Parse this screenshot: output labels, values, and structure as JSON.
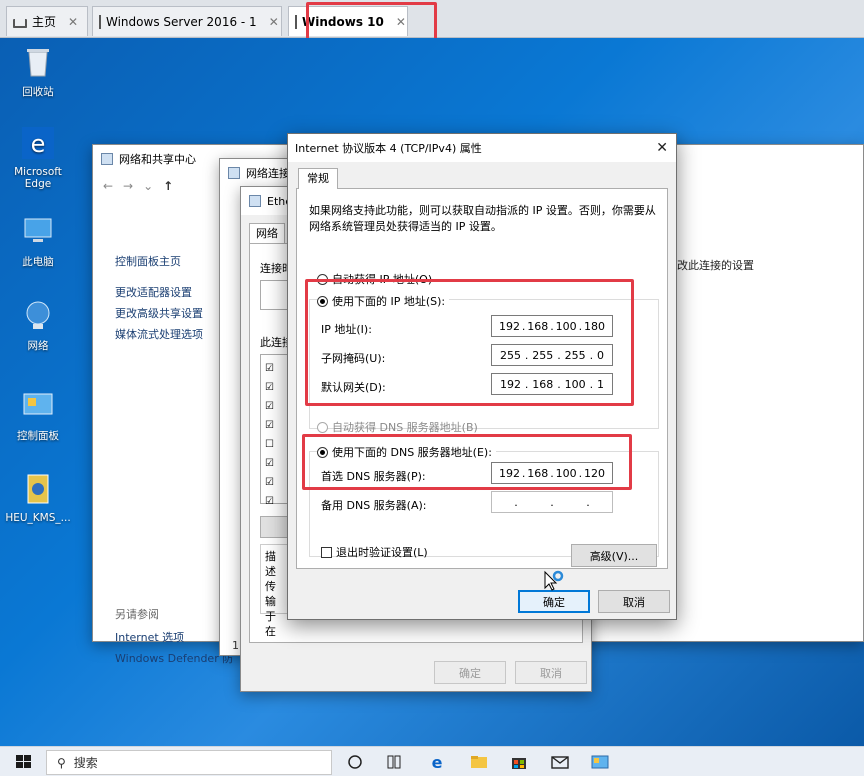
{
  "tabs": [
    {
      "label": "主页"
    },
    {
      "label": "Windows Server 2016 - 1"
    },
    {
      "label": "Windows 10"
    }
  ],
  "desktop_icons": [
    {
      "label": "回收站"
    },
    {
      "label": "Microsoft Edge"
    },
    {
      "label": "此电脑"
    },
    {
      "label": "网络"
    },
    {
      "label": "控制面板"
    },
    {
      "label": "HEU_KMS_..."
    }
  ],
  "network_center": {
    "title": "网络和共享中心",
    "left_links": [
      "控制面板主页",
      "更改适配器设置",
      "更改高级共享设置",
      "媒体流式处理选项"
    ],
    "see_also": "另请参阅",
    "bottom_links": [
      "Internet 选项",
      "Windows Defender 防"
    ],
    "right_link": "改此连接的设置"
  },
  "network_connections": {
    "title": "网络连接",
    "digit": "1"
  },
  "ethernet_props": {
    "title": "Ethe",
    "tab": "网络",
    "connect_using": "连接时",
    "items_label": "此连接",
    "desc_label": "描述",
    "desc_lines": [
      "传输",
      "于在"
    ],
    "ok": "确定",
    "cancel": "取消"
  },
  "dialog": {
    "title": "Internet 协议版本 4 (TCP/IPv4) 属性",
    "tab": "常规",
    "description": "如果网络支持此功能，则可以获取自动指派的 IP 设置。否则，你需要从网络系统管理员处获得适当的 IP 设置。",
    "auto_ip": "自动获得 IP 地址(O)",
    "manual_ip": "使用下面的 IP 地址(S):",
    "ip_label": "IP 地址(I):",
    "ip_value": [
      "192",
      "168",
      "100",
      "180"
    ],
    "mask_label": "子网掩码(U):",
    "mask_value": [
      "255",
      "255",
      "255",
      "0"
    ],
    "gateway_label": "默认网关(D):",
    "gateway_value": [
      "192",
      "168",
      "100",
      "1"
    ],
    "auto_dns": "自动获得 DNS 服务器地址(B)",
    "manual_dns": "使用下面的 DNS 服务器地址(E):",
    "preferred_dns_label": "首选 DNS 服务器(P):",
    "preferred_dns_value": [
      "192",
      "168",
      "100",
      "120"
    ],
    "alt_dns_label": "备用 DNS 服务器(A):",
    "validate_label": "退出时验证设置(L)",
    "advanced": "高级(V)...",
    "ok": "确定",
    "cancel": "取消"
  },
  "taskbar": {
    "search_placeholder": "搜索"
  }
}
